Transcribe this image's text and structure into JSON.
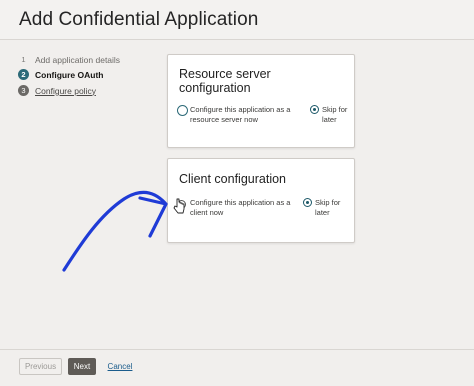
{
  "header": {
    "title": "Add Confidential Application"
  },
  "steps": [
    {
      "number": "1",
      "label": "Add application details",
      "state": "completed"
    },
    {
      "number": "2",
      "label": "Configure OAuth",
      "state": "current"
    },
    {
      "number": "3",
      "label": "Configure policy",
      "state": "upcoming"
    }
  ],
  "resource_server_card": {
    "title_line1": "Resource server",
    "title_line2": "configuration",
    "option_configure_line1": "Configure this application as a",
    "option_configure_line2": "resource server now",
    "option_skip_line1": "Skip for",
    "option_skip_line2": "later",
    "selected": "skip"
  },
  "client_card": {
    "title": "Client configuration",
    "option_configure_line1": "Configure this application as a",
    "option_configure_line2": "client now",
    "option_skip_line1": "Skip for",
    "option_skip_line2": "later",
    "selected": "skip"
  },
  "footer": {
    "previous_label": "Previous",
    "next_label": "Next",
    "cancel_label": "Cancel"
  },
  "colors": {
    "accent": "#2d6a78",
    "annotation_arrow": "#1f3bd6",
    "next_button": "#5f5b57",
    "link": "#1b5c8c"
  }
}
